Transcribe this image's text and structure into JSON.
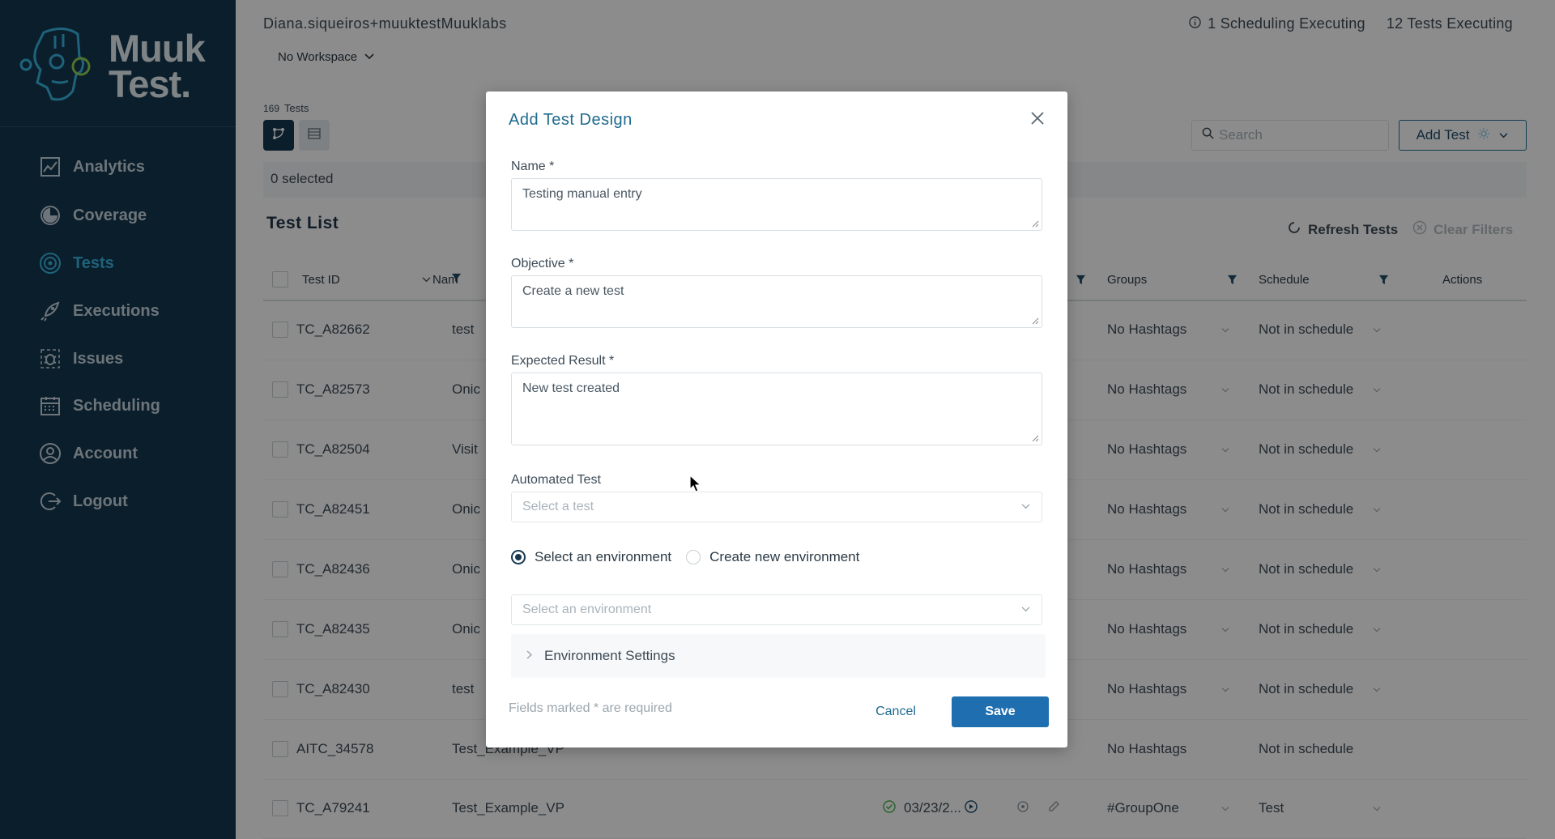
{
  "brand": {
    "logo_line1": "Muuk",
    "logo_line2": "Test."
  },
  "sidebar": {
    "items": [
      {
        "label": "Analytics",
        "icon": "analytics-icon"
      },
      {
        "label": "Coverage",
        "icon": "coverage-icon"
      },
      {
        "label": "Tests",
        "icon": "tests-icon",
        "active": true
      },
      {
        "label": "Executions",
        "icon": "rocket-icon"
      },
      {
        "label": "Issues",
        "icon": "bug-icon"
      },
      {
        "label": "Scheduling",
        "icon": "calendar-icon"
      },
      {
        "label": "Account",
        "icon": "user-icon"
      },
      {
        "label": "Logout",
        "icon": "logout-icon"
      }
    ]
  },
  "header": {
    "user": "Diana.siqueiros+muuktestMuuklabs",
    "scheduling_executing": "1 Scheduling Executing",
    "tests_executing": "12 Tests Executing",
    "workspace": "No Workspace"
  },
  "toolbar": {
    "count_number": "169",
    "count_label": "Tests",
    "selected": "0 selected",
    "search_placeholder": "Search",
    "add_test_label": "Add Test"
  },
  "list": {
    "title": "Test List",
    "refresh_label": "Refresh Tests",
    "clear_label": "Clear Filters",
    "columns": {
      "test_id": "Test ID",
      "name": "Nam",
      "groups": "Groups",
      "schedule": "Schedule",
      "actions": "Actions"
    },
    "rows": [
      {
        "id": "TC_A82662",
        "name": "test",
        "group": "No Hashtags",
        "schedule": "Not in schedule",
        "date": ""
      },
      {
        "id": "TC_A82573",
        "name": "Onic",
        "group": "No Hashtags",
        "schedule": "Not in schedule",
        "date": ""
      },
      {
        "id": "TC_A82504",
        "name": "Visit",
        "group": "No Hashtags",
        "schedule": "Not in schedule",
        "date": ""
      },
      {
        "id": "TC_A82451",
        "name": "Onic",
        "group": "No Hashtags",
        "schedule": "Not in schedule",
        "date": ""
      },
      {
        "id": "TC_A82436",
        "name": "Onic",
        "group": "No Hashtags",
        "schedule": "Not in schedule",
        "date": ""
      },
      {
        "id": "TC_A82435",
        "name": "Onic",
        "group": "No Hashtags",
        "schedule": "Not in schedule",
        "date": ""
      },
      {
        "id": "TC_A82430",
        "name": "test",
        "group": "No Hashtags",
        "schedule": "Not in schedule",
        "date": ""
      },
      {
        "id": "AITC_34578",
        "name": "Test_Example_VP",
        "group": "No Hashtags",
        "schedule": "Not in schedule",
        "date": ""
      },
      {
        "id": "TC_A79241",
        "name": "Test_Example_VP",
        "group": "#GroupOne",
        "schedule": "Test",
        "date": "03/23/2..."
      }
    ]
  },
  "modal": {
    "title": "Add Test Design",
    "name_label": "Name *",
    "name_value": "Testing manual entry",
    "objective_label": "Objective *",
    "objective_value": "Create a new test",
    "expected_label": "Expected Result *",
    "expected_value": "New test created",
    "automated_label": "Automated Test",
    "automated_placeholder": "Select a test",
    "radio_select_env": "Select an environment",
    "radio_create_env": "Create new environment",
    "env_placeholder": "Select an environment",
    "env_settings": "Environment Settings",
    "required_note": "Fields marked * are required",
    "cancel_label": "Cancel",
    "save_label": "Save"
  },
  "colors": {
    "sidebar": "#14374f",
    "accent": "#37b5e0",
    "save": "#1f6fb0",
    "title": "#1e6a8f"
  }
}
